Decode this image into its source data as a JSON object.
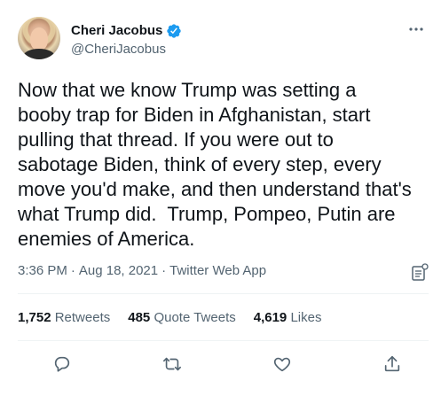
{
  "user": {
    "display_name": "Cheri Jacobus",
    "handle": "@CheriJacobus",
    "verified": true,
    "verified_color": "#1d9bf0"
  },
  "tweet": {
    "text": "Now that we know Trump was setting a\nbooby trap for Biden in Afghanistan, start\npulling that thread. If you were out to\nsabotage Biden, think of every step, every\nmove you'd make, and then understand that's\nwhat Trump did.  Trump, Pompeo, Putin are\nenemies of America.",
    "time": "3:36 PM",
    "separator": "·",
    "date": "Aug 18, 2021",
    "source": "Twitter Web App"
  },
  "stats": {
    "retweets_count": "1,752",
    "retweets_label": "Retweets",
    "quotes_count": "485",
    "quotes_label": "Quote Tweets",
    "likes_count": "4,619",
    "likes_label": "Likes"
  },
  "icons": {
    "more": "more-icon",
    "analytics": "analytics-icon",
    "reply": "reply-icon",
    "retweet": "retweet-icon",
    "like": "like-icon",
    "share": "share-icon"
  },
  "colors": {
    "text": "#0f1419",
    "secondary": "#536471",
    "divider": "#eff3f4"
  }
}
